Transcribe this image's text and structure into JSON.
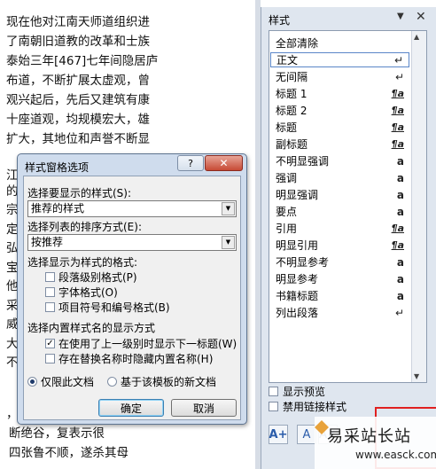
{
  "document": {
    "lines": [
      "现在他对江南天师道组织进",
      "了南朝旧道教的改革和士族",
      "泰始三年[467]七年间隐居庐",
      "布道，不断扩展太虚观，曾",
      "观兴起后，先后又建筑有康",
      "十座道观，均规模宏大，雄",
      "扩大，其地位和声誉不断显",
      "，遂",
      "断绝谷，复表示很",
      "四张鲁不顺，遂杀其母"
    ],
    "left_fragments": [
      "江",
      "的",
      "宗",
      "定",
      "弘",
      "宝",
      "他",
      "采",
      "威",
      "大",
      "不"
    ]
  },
  "styles_pane": {
    "title": "样式",
    "menu_icon": "▼",
    "close_icon": "✕",
    "items": [
      {
        "name": "全部清除",
        "mark": ""
      },
      {
        "name": "正文",
        "mark": "↵"
      },
      {
        "name": "无间隔",
        "mark": "↵"
      },
      {
        "name": "标题 1",
        "mark": "¶a"
      },
      {
        "name": "标题 2",
        "mark": "¶a"
      },
      {
        "name": "标题",
        "mark": "¶a"
      },
      {
        "name": "副标题",
        "mark": "¶a"
      },
      {
        "name": "不明显强调",
        "mark": "a"
      },
      {
        "name": "强调",
        "mark": "a"
      },
      {
        "name": "明显强调",
        "mark": "a"
      },
      {
        "name": "要点",
        "mark": "a"
      },
      {
        "name": "引用",
        "mark": "¶a"
      },
      {
        "name": "明显引用",
        "mark": "¶a"
      },
      {
        "name": "不明显参考",
        "mark": "a"
      },
      {
        "name": "明显参考",
        "mark": "a"
      },
      {
        "name": "书籍标题",
        "mark": "a"
      },
      {
        "name": "列出段落",
        "mark": "↵"
      }
    ],
    "show_preview": "显示预览",
    "disable_linked": "禁用链接样式"
  },
  "dialog": {
    "title": "样式窗格选项",
    "help": "?",
    "close": "✕",
    "select_styles_label": "选择要显示的样式(S):",
    "select_styles_value": "推荐的样式",
    "sort_label": "选择列表的排序方式(E):",
    "sort_value": "按推荐",
    "format_label": "选择显示为样式的格式:",
    "format_paragraph": "段落级别格式(P)",
    "format_font": "字体格式(O)",
    "format_bullets": "项目符号和编号格式(B)",
    "builtin_label": "选择内置样式名的显示方式",
    "builtin_next_heading": "在使用了上一级别时显示下一标题(W)",
    "builtin_hide": "存在替换名称时隐藏内置名称(H)",
    "radio_doc_only": "仅限此文档",
    "radio_template": "基于该模板的新文档",
    "ok": "确定",
    "cancel": "取消"
  },
  "watermark": {
    "text": "易采站长站",
    "url": "www.easck.com"
  }
}
